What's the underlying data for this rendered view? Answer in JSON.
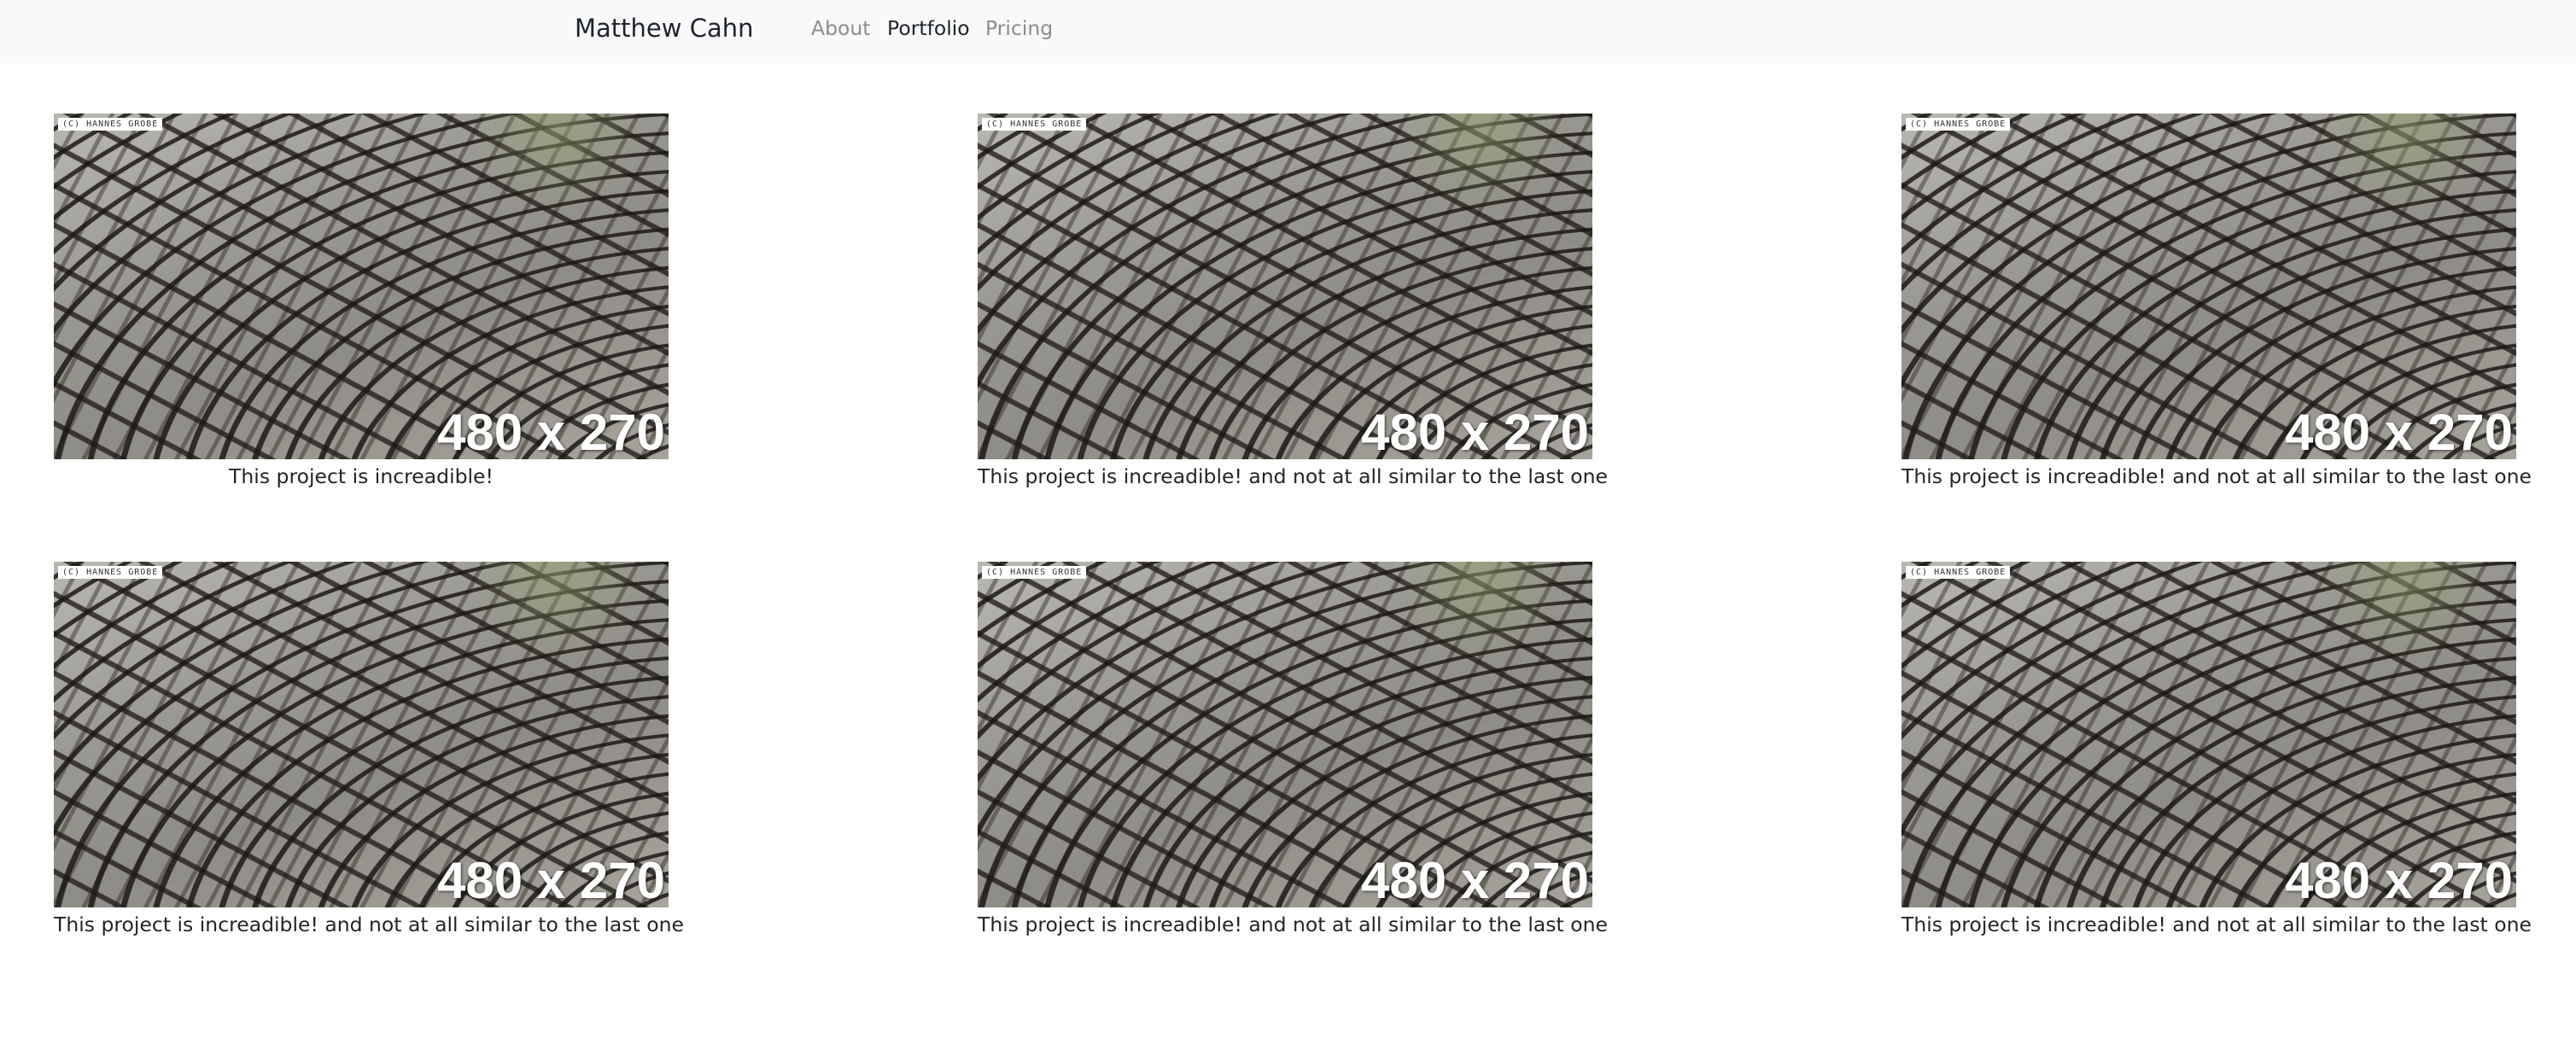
{
  "navbar": {
    "brand": "Matthew Cahn",
    "links": [
      {
        "label": "About",
        "active": false
      },
      {
        "label": "Portfolio",
        "active": true
      },
      {
        "label": "Pricing",
        "active": false
      }
    ]
  },
  "colors": {
    "navbar_bg": "#f8f9fa",
    "active_link": "#212529",
    "inactive_link": "#8c8c8c"
  },
  "projects": [
    {
      "image_copyright": "(C) HANNES GROBE",
      "image_size": "480 x 270",
      "caption": "This project is increadible!"
    },
    {
      "image_copyright": "(C) HANNES GROBE",
      "image_size": "480 x 270",
      "caption": "This project is increadible! and not at all similar to the last one"
    },
    {
      "image_copyright": "(C) HANNES GROBE",
      "image_size": "480 x 270",
      "caption": "This project is increadible! and not at all similar to the last one"
    },
    {
      "image_copyright": "(C) HANNES GROBE",
      "image_size": "480 x 270",
      "caption": "This project is increadible! and not at all similar to the last one"
    },
    {
      "image_copyright": "(C) HANNES GROBE",
      "image_size": "480 x 270",
      "caption": "This project is increadible! and not at all similar to the last one"
    },
    {
      "image_copyright": "(C) HANNES GROBE",
      "image_size": "480 x 270",
      "caption": "This project is increadible! and not at all similar to the last one"
    }
  ]
}
